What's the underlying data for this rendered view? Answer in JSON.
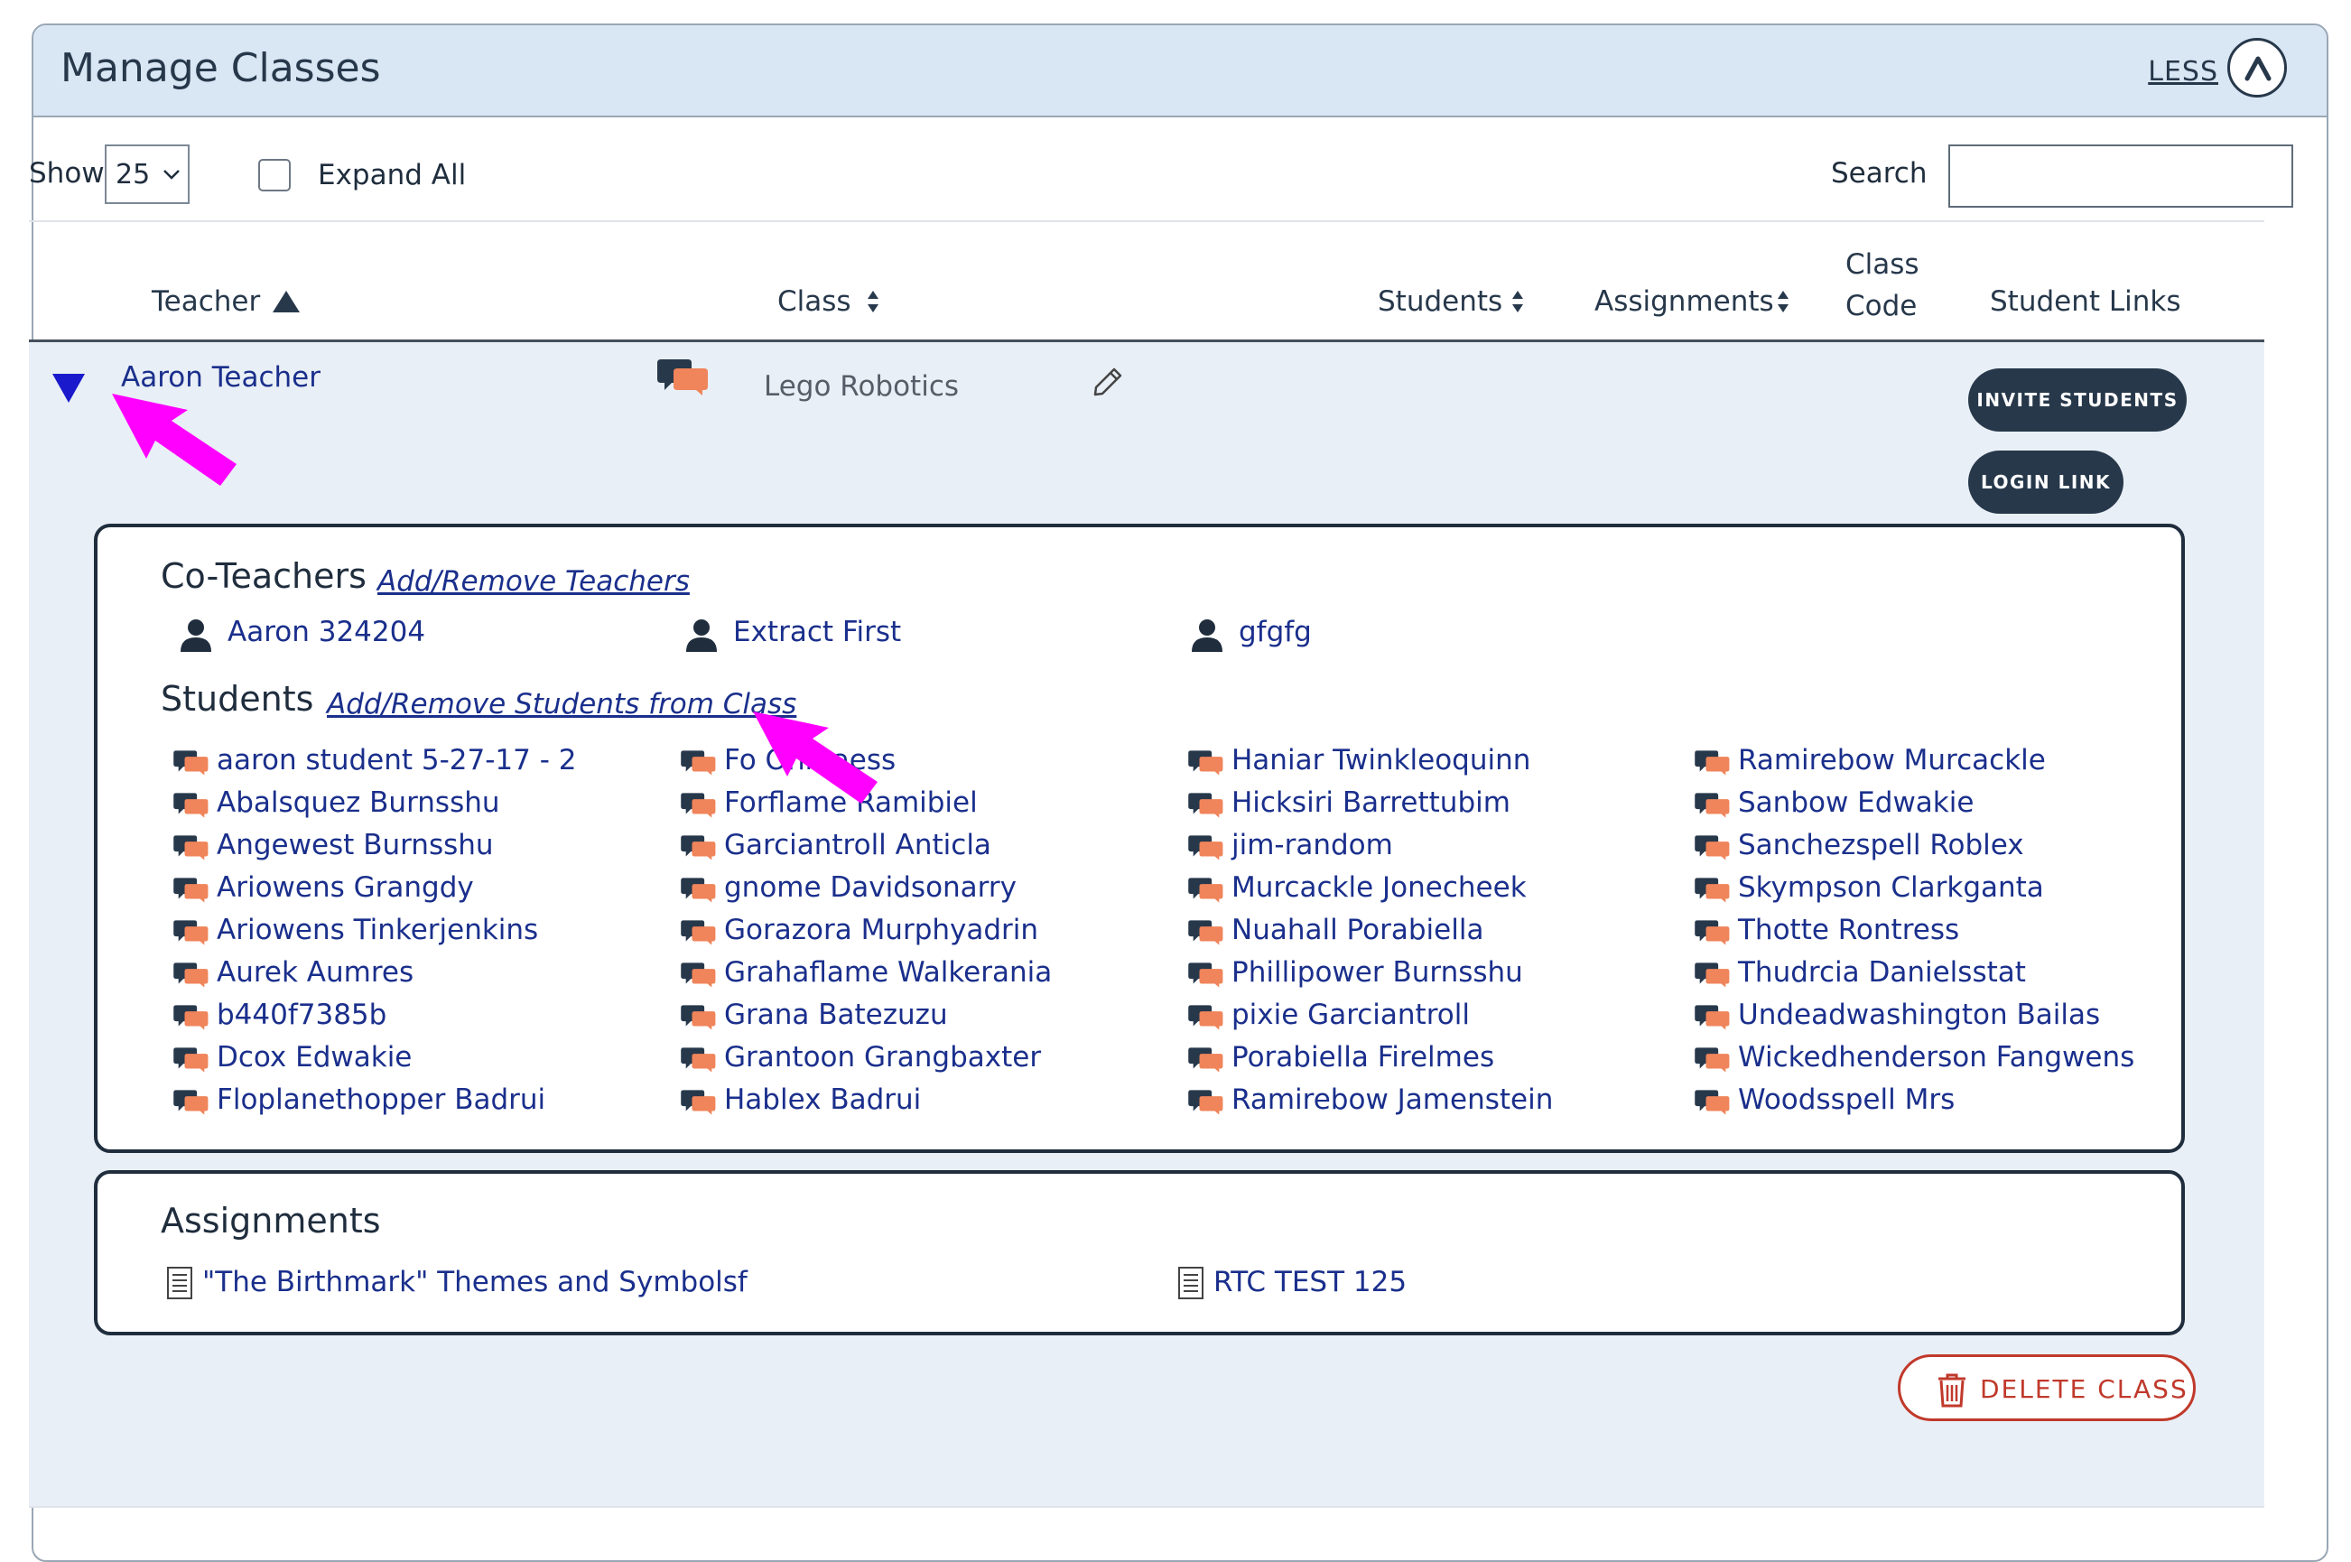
{
  "header": {
    "title": "Manage Classes",
    "less_label": "LESS",
    "less_icon": "chevron-up-icon"
  },
  "controls": {
    "show_label": "Show",
    "show_value": "25",
    "expand_all_label": "Expand All",
    "search_label": "Search",
    "search_value": ""
  },
  "table": {
    "columns": {
      "teacher": "Teacher",
      "class": "Class",
      "students": "Students",
      "assignments": "Assignments",
      "class_code_1": "Class",
      "class_code_2": "Code",
      "student_links": "Student Links"
    }
  },
  "row": {
    "teacher": "Aaron Teacher",
    "class_name": "Lego Robotics",
    "invite_label": "INVITE STUDENTS",
    "login_label": "LOGIN LINK"
  },
  "coteachers": {
    "title": "Co-Teachers",
    "link": "Add/Remove Teachers",
    "items": [
      "Aaron 324204",
      "Extract First",
      "gfgfg"
    ]
  },
  "students": {
    "title": "Students",
    "link": "Add/Remove Students from Class",
    "items": [
      "aaron student 5-27-17 - 2",
      "Abalsquez Burnsshu",
      "Angewest Burnsshu",
      "Ariowens Grangdy",
      "Ariowens Tinkerjenkins",
      "Aurek Aumres",
      "b440f7385b",
      "Dcox Edwakie",
      "Floplanethopper Badrui",
      "Fo Ohmaess",
      "Forflame Ramibiel",
      "Garciantroll Anticla",
      "gnome Davidsonarry",
      "Gorazora Murphyadrin",
      "Grahaflame Walkerania",
      "Grana Batezuzu",
      "Grantoon Grangbaxter",
      "Hablex Badrui",
      "Haniar Twinkleoquinn",
      "Hicksiri Barrettubim",
      "jim-random",
      "Murcackle Jonecheek",
      "Nuahall Porabiella",
      "Phillipower Burnsshu",
      "pixie Garciantroll",
      "Porabiella Firelmes",
      "Ramirebow Jamenstein",
      "Ramirebow Murcackle",
      "Sanbow Edwakie",
      "Sanchezspell Roblex",
      "Skympson Clarkganta",
      "Thotte Rontress",
      "Thudrcia Danielsstat",
      "Undeadwashington Bailas",
      "Wickedhenderson Fangwens",
      "Woodsspell Mrs"
    ]
  },
  "assignments": {
    "title": "Assignments",
    "items": [
      "\"The Birthmark\" Themes and Symbolsf",
      "RTC TEST 125"
    ]
  },
  "delete_label": "DELETE CLASS",
  "colors": {
    "navy": "#27384b",
    "link": "#1a2f8c",
    "header_bg": "#d9e6f3",
    "row_bg": "#e9eff6",
    "delete": "#c0392b",
    "chat_orange": "#f0845a",
    "annotation_arrow": "#ff00ff"
  }
}
